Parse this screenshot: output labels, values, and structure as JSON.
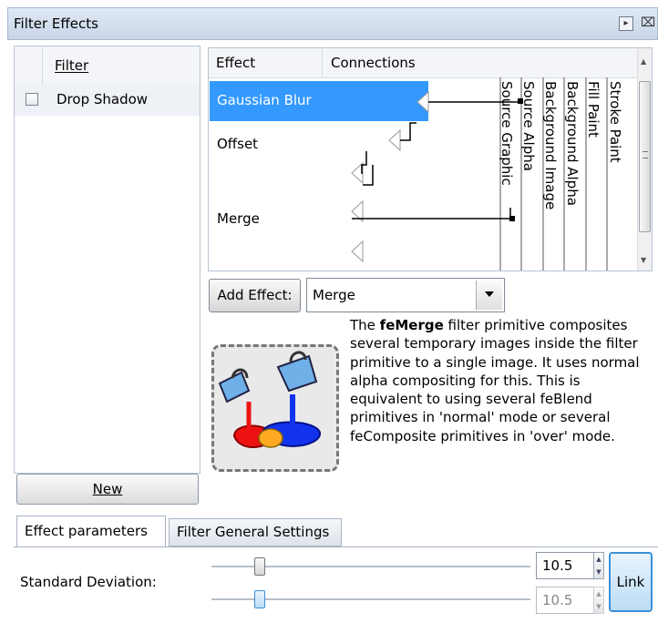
{
  "window": {
    "title": "Filter Effects",
    "dock_icon": "dock-icon",
    "close_icon": "close-icon"
  },
  "filter_list": {
    "column_header": "Filter",
    "items": [
      {
        "label": "Drop Shadow",
        "checked": false
      }
    ],
    "new_button": "New"
  },
  "effects": {
    "col_effect": "Effect",
    "col_connections": "Connections",
    "rows": [
      {
        "label": "Gaussian Blur",
        "selected": true
      },
      {
        "label": "Offset",
        "selected": false
      },
      {
        "label": "Merge",
        "selected": false
      }
    ],
    "inputs": [
      "Source Graphic",
      "Source Alpha",
      "Background Image",
      "Background Alpha",
      "Fill Paint",
      "Stroke Paint"
    ]
  },
  "add_effect": {
    "button_label": "Add Effect:",
    "selected": "Merge"
  },
  "description": {
    "prefix": "The ",
    "name": "feMerge",
    "text": " filter primitive composites several temporary images inside the filter primitive to a single image. It uses normal alpha compositing for this. This is equivalent to using several feBlend primitives in 'normal' mode or several feComposite primitives in 'over' mode."
  },
  "tabs": [
    {
      "label": "Effect parameters",
      "active": true
    },
    {
      "label": "Filter General Settings",
      "active": false
    }
  ],
  "params": {
    "std_dev_label": "Standard Deviation:",
    "value1": "10.5",
    "value2": "10.5",
    "link_label": "Link",
    "slider1_fraction": 0.15,
    "slider2_fraction": 0.15
  },
  "colors": {
    "selection": "#3399ff",
    "link_border": "#3b8fd6"
  }
}
